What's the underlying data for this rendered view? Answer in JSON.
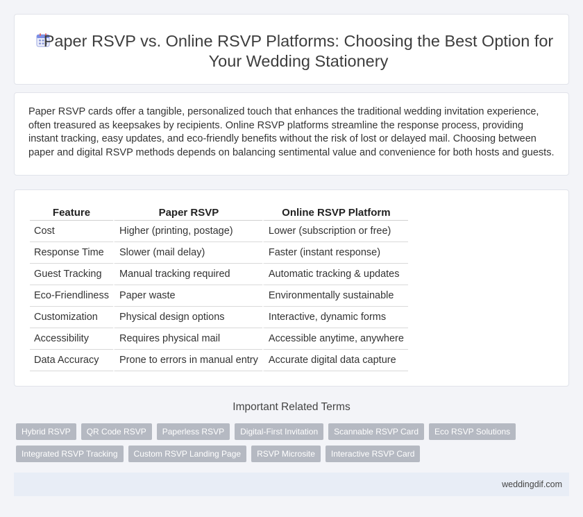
{
  "title": "Paper RSVP vs. Online RSVP Platforms: Choosing the Best Option for Your Wedding Stationery",
  "title_icon": "calendar-icon",
  "intro": "Paper RSVP cards offer a tangible, personalized touch that enhances the traditional wedding invitation experience, often treasured as keepsakes by recipients. Online RSVP platforms streamline the response process, providing instant tracking, easy updates, and eco-friendly benefits without the risk of lost or delayed mail. Choosing between paper and digital RSVP methods depends on balancing sentimental value and convenience for both hosts and guests.",
  "table": {
    "headers": [
      "Feature",
      "Paper RSVP",
      "Online RSVP Platform"
    ],
    "rows": [
      [
        "Cost",
        "Higher (printing, postage)",
        "Lower (subscription or free)"
      ],
      [
        "Response Time",
        "Slower (mail delay)",
        "Faster (instant response)"
      ],
      [
        "Guest Tracking",
        "Manual tracking required",
        "Automatic tracking & updates"
      ],
      [
        "Eco-Friendliness",
        "Paper waste",
        "Environmentally sustainable"
      ],
      [
        "Customization",
        "Physical design options",
        "Interactive, dynamic forms"
      ],
      [
        "Accessibility",
        "Requires physical mail",
        "Accessible anytime, anywhere"
      ],
      [
        "Data Accuracy",
        "Prone to errors in manual entry",
        "Accurate digital data capture"
      ]
    ]
  },
  "related": {
    "title": "Important Related Terms",
    "rows": [
      [
        "Hybrid RSVP",
        "QR Code RSVP",
        "Paperless RSVP",
        "Digital-First Invitation",
        "Scannable RSVP Card",
        "Eco RSVP Solutions"
      ],
      [
        "Integrated RSVP Tracking",
        "Custom RSVP Landing Page",
        "RSVP Microsite",
        "Interactive RSVP Card"
      ]
    ]
  },
  "footer": "weddingdif.com",
  "colors": {
    "tag_bg": "#b5b9c2",
    "footer_bg": "#e8edf6",
    "page_bg": "#f3f4f8"
  }
}
